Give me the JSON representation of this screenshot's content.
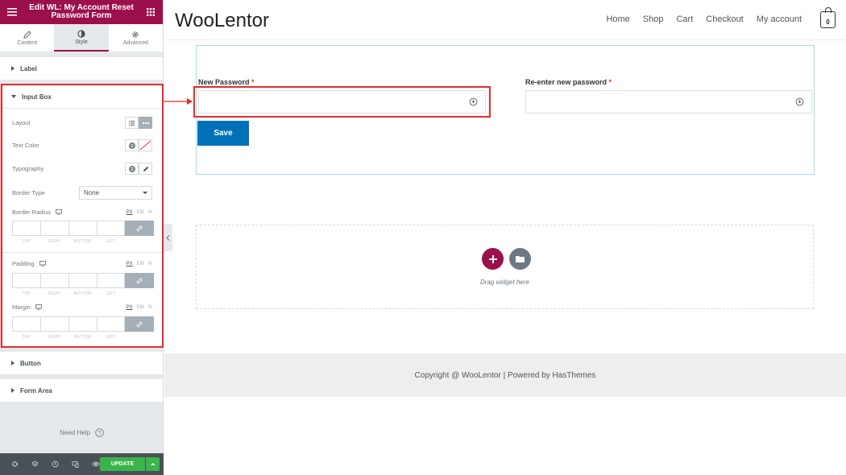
{
  "editor": {
    "title": "Edit WL: My Account Reset Password Form",
    "tabs": [
      {
        "label": "Content",
        "icon": "pencil-icon"
      },
      {
        "label": "Style",
        "icon": "half-circle-icon",
        "active": true
      },
      {
        "label": "Advanced",
        "icon": "gear-icon"
      }
    ],
    "sections": {
      "label": "Label",
      "input_box": "Input Box",
      "button": "Button",
      "form_area": "Form Area"
    },
    "controls": {
      "layout": "Layout",
      "text_color": "Text Color",
      "typography": "Typography",
      "border_type": "Border Type",
      "border_type_value": "None",
      "border_radius": "Border Radius",
      "padding": "Padding",
      "margin": "Margin",
      "units": [
        "PX",
        "EM",
        "%"
      ],
      "dimensions": [
        "TOP",
        "RIGHT",
        "BOTTOM",
        "LEFT"
      ]
    },
    "need_help": "Need Help",
    "update": "UPDATE"
  },
  "site": {
    "logo": "WooLentor",
    "nav": [
      "Home",
      "Shop",
      "Cart",
      "Checkout",
      "My account"
    ],
    "cart_count": "0"
  },
  "form": {
    "new_password_label": "New Password",
    "reenter_label": "Re-enter new password",
    "required_mark": "*",
    "save_label": "Save"
  },
  "dropzone": {
    "text": "Drag widget here"
  },
  "footer": {
    "text": "Copyright @ WooLentor | Powered by HasThemes"
  },
  "colors": {
    "brand": "#9b0f4b",
    "highlight": "#e52b2b",
    "save": "#0071b8",
    "update": "#39b54a"
  }
}
